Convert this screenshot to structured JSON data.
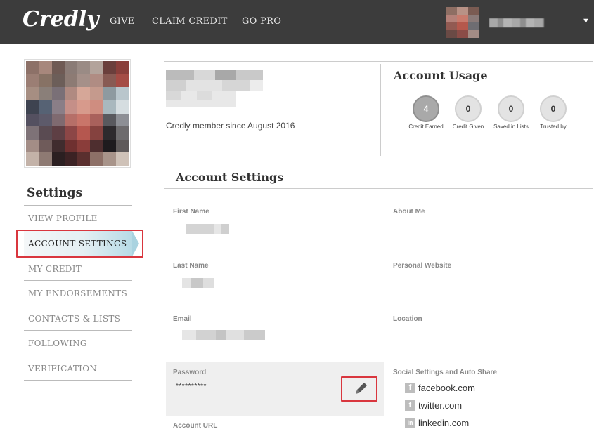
{
  "header": {
    "logo": "Credly",
    "nav": [
      "GIVE",
      "CLAIM CREDIT",
      "GO PRO"
    ],
    "dropdown_icon": "▼"
  },
  "profile": {
    "member_since": "Credly member since August 2016"
  },
  "account_usage": {
    "title": "Account Usage",
    "stats": [
      {
        "value": "4",
        "label": "Credit Earned"
      },
      {
        "value": "0",
        "label": "Credit Given"
      },
      {
        "value": "0",
        "label": "Saved in Lists"
      },
      {
        "value": "0",
        "label": "Trusted by"
      }
    ]
  },
  "sidebar": {
    "title": "Settings",
    "items": [
      {
        "label": "VIEW PROFILE"
      },
      {
        "label": "ACCOUNT SETTINGS"
      },
      {
        "label": "MY CREDIT"
      },
      {
        "label": "MY ENDORSEMENTS"
      },
      {
        "label": "CONTACTS & LISTS"
      },
      {
        "label": "FOLLOWING"
      },
      {
        "label": "VERIFICATION"
      }
    ],
    "active_index": 1
  },
  "account_settings": {
    "title": "Account Settings",
    "left_fields": {
      "first_name": "First Name",
      "last_name": "Last Name",
      "email": "Email",
      "password": "Password",
      "password_value": "**********",
      "account_url": "Account URL"
    },
    "right_fields": {
      "about_me": "About Me",
      "personal_website": "Personal Website",
      "location": "Location",
      "social": "Social Settings and Auto Share"
    },
    "social_links": [
      {
        "icon": "f",
        "label": "facebook.com"
      },
      {
        "icon": "t",
        "label": "twitter.com"
      },
      {
        "icon": "in",
        "label": "linkedin.com"
      }
    ]
  },
  "colors": {
    "topbar": "#3c3c3c",
    "highlight": "#d9363e",
    "active_tab": "#b7dbe6"
  }
}
